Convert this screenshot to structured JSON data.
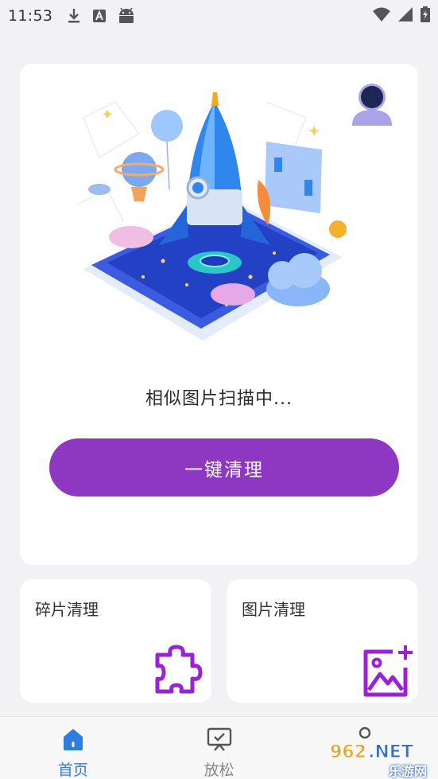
{
  "status_bar": {
    "time": "11:53",
    "icons": [
      "download-icon",
      "a-letter-icon",
      "android-icon",
      "wifi-icon",
      "signal-icon",
      "battery-icon"
    ]
  },
  "main_card": {
    "scan_status": "相似图片扫描中...",
    "clean_button_label": "一键清理",
    "accent_color": "#8e37c2"
  },
  "features": [
    {
      "title": "碎片清理",
      "icon": "puzzle-icon"
    },
    {
      "title": "图片清理",
      "icon": "add-image-icon"
    }
  ],
  "bottom_nav": {
    "items": [
      {
        "label": "首页",
        "icon": "home-icon",
        "active": true
      },
      {
        "label": "放松",
        "icon": "monitor-check-icon",
        "active": false
      },
      {
        "label": "",
        "icon": "profile-icon",
        "active": false
      }
    ],
    "active_color": "#2f7de1"
  },
  "watermark": {
    "logo_text": "962.NET",
    "site_name": "乐游网"
  }
}
